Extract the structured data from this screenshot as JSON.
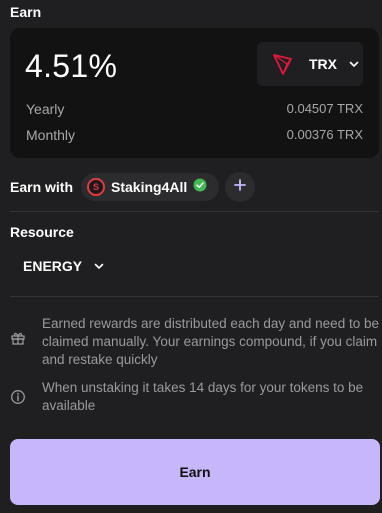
{
  "header": {
    "title": "Earn"
  },
  "summary": {
    "apy": "4.51%",
    "token": {
      "name": "TRX",
      "icon": "tron-logo-icon",
      "brand_color": "#e5173a"
    },
    "rows": [
      {
        "label": "Yearly",
        "value": "0.04507 TRX"
      },
      {
        "label": "Monthly",
        "value": "0.00376 TRX"
      }
    ]
  },
  "earn_with": {
    "label": "Earn with",
    "validator": {
      "name": "Staking4All",
      "logo_letter": "S",
      "verified_icon": "verified-check-icon"
    },
    "add_icon": "plus-icon"
  },
  "resource": {
    "title": "Resource",
    "selected": "ENERGY"
  },
  "info": [
    {
      "icon": "gift-icon",
      "text": "Earned rewards are distributed each day and need to be claimed manually. Your earnings compound, if you claim and restake quickly"
    },
    {
      "icon": "info-circle-icon",
      "text": "When unstaking it takes 14 days for your tokens to be available"
    }
  ],
  "action": {
    "label": "Earn",
    "color": "#c8b6fb"
  }
}
